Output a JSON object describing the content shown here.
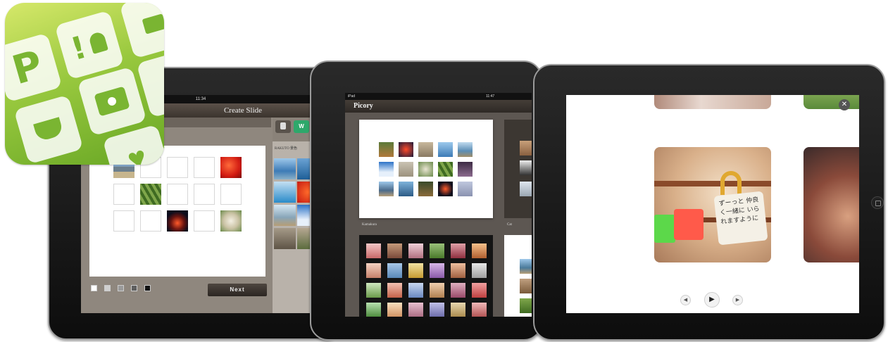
{
  "ipad_create": {
    "clock": "11:34",
    "title": "Create Slide",
    "next_label": "Next",
    "side_label": "RAKUTO 景色",
    "side_tab1": "Cam",
    "side_tab2": "W",
    "side_tab_sub": "webalbums"
  },
  "ipad_picory": {
    "status_left": "iPad",
    "clock": "11:47",
    "app_title": "Picory",
    "album_label_1": "Kamakura",
    "album_label_2": "Cat"
  },
  "ipad_viewer": {
    "close_icon": "close-icon",
    "prev_icon": "previous-icon",
    "play_icon": "play-icon",
    "next_icon": "next-icon",
    "photo_sign_text": "ずーっと 仲良く一緒に いられますように"
  },
  "app_icon": {
    "letter": "P",
    "exclaim": "!"
  },
  "colors": {
    "icon_green": "#7ab532",
    "next_button": "#2b2622"
  }
}
